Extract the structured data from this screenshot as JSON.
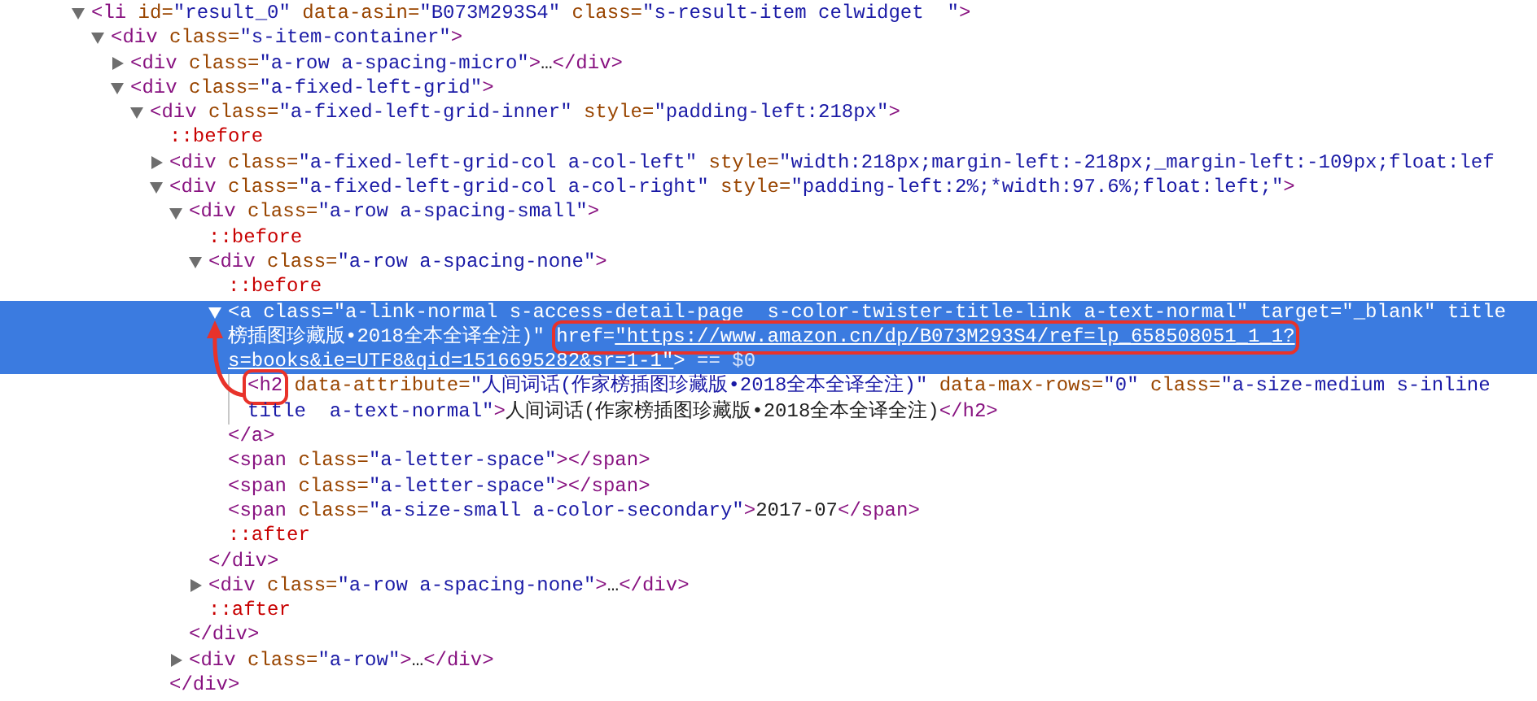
{
  "elements_panel": {
    "nodes": [
      {
        "selected": false,
        "expanded": true,
        "open": [
          {
            "kind": "tag",
            "text": "<li"
          },
          {
            "kind": "attr",
            "text": " id="
          },
          {
            "kind": "value",
            "text": "\"result_0\""
          },
          {
            "kind": "attr",
            "text": " data-asin="
          },
          {
            "kind": "value",
            "text": "\"B073M293S4\""
          },
          {
            "kind": "attr",
            "text": " class="
          },
          {
            "kind": "value",
            "text": "\"s-result-item celwidget  \""
          },
          {
            "kind": "tag",
            "text": ">"
          }
        ],
        "children": [
          {
            "selected": false,
            "expanded": true,
            "open": [
              {
                "kind": "tag",
                "text": "<div"
              },
              {
                "kind": "attr",
                "text": " class="
              },
              {
                "kind": "value",
                "text": "\"s-item-container\""
              },
              {
                "kind": "tag",
                "text": ">"
              }
            ],
            "children": [
              {
                "selected": false,
                "expanded": false,
                "open": [
                  {
                    "kind": "tag",
                    "text": "<div"
                  },
                  {
                    "kind": "attr",
                    "text": " class="
                  },
                  {
                    "kind": "value",
                    "text": "\"a-row a-spacing-micro\""
                  },
                  {
                    "kind": "tag",
                    "text": ">"
                  },
                  {
                    "kind": "text",
                    "text": "…"
                  },
                  {
                    "kind": "tag",
                    "text": "</div>"
                  }
                ]
              },
              {
                "selected": false,
                "expanded": true,
                "open": [
                  {
                    "kind": "tag",
                    "text": "<div"
                  },
                  {
                    "kind": "attr",
                    "text": " class="
                  },
                  {
                    "kind": "value",
                    "text": "\"a-fixed-left-grid\""
                  },
                  {
                    "kind": "tag",
                    "text": ">"
                  }
                ],
                "children": [
                  {
                    "selected": false,
                    "expanded": true,
                    "open": [
                      {
                        "kind": "tag",
                        "text": "<div"
                      },
                      {
                        "kind": "attr",
                        "text": " class="
                      },
                      {
                        "kind": "value",
                        "text": "\"a-fixed-left-grid-inner\""
                      },
                      {
                        "kind": "attr",
                        "text": " style="
                      },
                      {
                        "kind": "value",
                        "text": "\"padding-left:218px\""
                      },
                      {
                        "kind": "tag",
                        "text": ">"
                      }
                    ],
                    "children": [
                      {
                        "selected": false,
                        "open": [
                          {
                            "kind": "pseudo",
                            "text": "::before"
                          }
                        ]
                      },
                      {
                        "selected": false,
                        "expanded": false,
                        "open": [
                          {
                            "kind": "tag",
                            "text": "<div"
                          },
                          {
                            "kind": "attr",
                            "text": " class="
                          },
                          {
                            "kind": "value",
                            "text": "\"a-fixed-left-grid-col a-col-left\""
                          },
                          {
                            "kind": "attr",
                            "text": " style="
                          },
                          {
                            "kind": "value",
                            "text": "\"width:218px;margin-left:-218px;_margin-left:-109px;float:lef"
                          }
                        ]
                      },
                      {
                        "selected": false,
                        "expanded": true,
                        "open": [
                          {
                            "kind": "tag",
                            "text": "<div"
                          },
                          {
                            "kind": "attr",
                            "text": " class="
                          },
                          {
                            "kind": "value",
                            "text": "\"a-fixed-left-grid-col a-col-right\""
                          },
                          {
                            "kind": "attr",
                            "text": " style="
                          },
                          {
                            "kind": "value",
                            "text": "\"padding-left:2%;*width:97.6%;float:left;\""
                          },
                          {
                            "kind": "tag",
                            "text": ">"
                          }
                        ],
                        "children": [
                          {
                            "selected": false,
                            "expanded": true,
                            "open": [
                              {
                                "kind": "tag",
                                "text": "<div"
                              },
                              {
                                "kind": "attr",
                                "text": " class="
                              },
                              {
                                "kind": "value",
                                "text": "\"a-row a-spacing-small\""
                              },
                              {
                                "kind": "tag",
                                "text": ">"
                              }
                            ],
                            "children": [
                              {
                                "selected": false,
                                "open": [
                                  {
                                    "kind": "pseudo",
                                    "text": "::before"
                                  }
                                ]
                              },
                              {
                                "selected": false,
                                "expanded": true,
                                "open": [
                                  {
                                    "kind": "tag",
                                    "text": "<div"
                                  },
                                  {
                                    "kind": "attr",
                                    "text": " class="
                                  },
                                  {
                                    "kind": "value",
                                    "text": "\"a-row a-spacing-none\""
                                  },
                                  {
                                    "kind": "tag",
                                    "text": ">"
                                  }
                                ],
                                "children": [
                                  {
                                    "selected": false,
                                    "open": [
                                      {
                                        "kind": "pseudo",
                                        "text": "::before"
                                      }
                                    ]
                                  },
                                  {
                                    "selected": true,
                                    "expanded": true,
                                    "open": [
                                      {
                                        "kind": "tag",
                                        "text": "<a"
                                      },
                                      {
                                        "kind": "attr",
                                        "text": " class="
                                      },
                                      {
                                        "kind": "value",
                                        "text": "\"a-link-normal s-access-detail-page  s-color-twister-title-link a-text-normal\""
                                      },
                                      {
                                        "kind": "attr",
                                        "text": " target="
                                      },
                                      {
                                        "kind": "value",
                                        "text": "\"_blank\""
                                      },
                                      {
                                        "kind": "attr",
                                        "text": " title"
                                      },
                                      {
                                        "kind": "break"
                                      },
                                      {
                                        "kind": "value",
                                        "text": "榜插图珍藏版•2018全本全译全注)\" "
                                      },
                                      {
                                        "kind": "attr",
                                        "text": "href=",
                                        "boxed": true
                                      },
                                      {
                                        "kind": "link",
                                        "text": "\"https://www.amazon.cn/dp/B073M293S4/ref=lp_658508051_1_1?",
                                        "boxed": true
                                      },
                                      {
                                        "kind": "break"
                                      },
                                      {
                                        "kind": "link",
                                        "text": "s=books&ie=UTF8&qid=1516695282&sr=1-1\""
                                      },
                                      {
                                        "kind": "tag",
                                        "text": ">"
                                      },
                                      {
                                        "kind": "ref",
                                        "text": " == $0"
                                      }
                                    ],
                                    "children": [
                                      {
                                        "selected": false,
                                        "open": [
                                          {
                                            "kind": "tag",
                                            "text": "<h2",
                                            "boxed": true
                                          },
                                          {
                                            "kind": "attr",
                                            "text": " data-attribute="
                                          },
                                          {
                                            "kind": "value",
                                            "text": "\"人间词话(作家榜插图珍藏版•2018全本全译全注)\""
                                          },
                                          {
                                            "kind": "attr",
                                            "text": " data-max-rows="
                                          },
                                          {
                                            "kind": "value",
                                            "text": "\"0\""
                                          },
                                          {
                                            "kind": "attr",
                                            "text": " class="
                                          },
                                          {
                                            "kind": "value",
                                            "text": "\"a-size-medium s-inline"
                                          },
                                          {
                                            "kind": "break"
                                          },
                                          {
                                            "kind": "value",
                                            "text": "title  a-text-normal\""
                                          },
                                          {
                                            "kind": "tag",
                                            "text": ">"
                                          },
                                          {
                                            "kind": "text",
                                            "text": "人间词话(作家榜插图珍藏版•2018全本全译全注)"
                                          },
                                          {
                                            "kind": "tag",
                                            "text": "</h2>"
                                          }
                                        ]
                                      }
                                    ],
                                    "close": [
                                      {
                                        "kind": "tag",
                                        "text": "</a>"
                                      }
                                    ]
                                  },
                                  {
                                    "selected": false,
                                    "open": [
                                      {
                                        "kind": "tag",
                                        "text": "<span"
                                      },
                                      {
                                        "kind": "attr",
                                        "text": " class="
                                      },
                                      {
                                        "kind": "value",
                                        "text": "\"a-letter-space\""
                                      },
                                      {
                                        "kind": "tag",
                                        "text": "></span>"
                                      }
                                    ]
                                  },
                                  {
                                    "selected": false,
                                    "open": [
                                      {
                                        "kind": "tag",
                                        "text": "<span"
                                      },
                                      {
                                        "kind": "attr",
                                        "text": " class="
                                      },
                                      {
                                        "kind": "value",
                                        "text": "\"a-letter-space\""
                                      },
                                      {
                                        "kind": "tag",
                                        "text": "></span>"
                                      }
                                    ]
                                  },
                                  {
                                    "selected": false,
                                    "open": [
                                      {
                                        "kind": "tag",
                                        "text": "<span"
                                      },
                                      {
                                        "kind": "attr",
                                        "text": " class="
                                      },
                                      {
                                        "kind": "value",
                                        "text": "\"a-size-small a-color-secondary\""
                                      },
                                      {
                                        "kind": "tag",
                                        "text": ">"
                                      },
                                      {
                                        "kind": "text",
                                        "text": "2017-07"
                                      },
                                      {
                                        "kind": "tag",
                                        "text": "</span>"
                                      }
                                    ]
                                  },
                                  {
                                    "selected": false,
                                    "open": [
                                      {
                                        "kind": "pseudo",
                                        "text": "::after"
                                      }
                                    ]
                                  }
                                ],
                                "close": [
                                  {
                                    "kind": "tag",
                                    "text": "</div>"
                                  }
                                ]
                              },
                              {
                                "selected": false,
                                "expanded": false,
                                "open": [
                                  {
                                    "kind": "tag",
                                    "text": "<div"
                                  },
                                  {
                                    "kind": "attr",
                                    "text": " class="
                                  },
                                  {
                                    "kind": "value",
                                    "text": "\"a-row a-spacing-none\""
                                  },
                                  {
                                    "kind": "tag",
                                    "text": ">"
                                  },
                                  {
                                    "kind": "text",
                                    "text": "…"
                                  },
                                  {
                                    "kind": "tag",
                                    "text": "</div>"
                                  }
                                ]
                              },
                              {
                                "selected": false,
                                "open": [
                                  {
                                    "kind": "pseudo",
                                    "text": "::after"
                                  }
                                ]
                              }
                            ],
                            "close": [
                              {
                                "kind": "tag",
                                "text": "</div>"
                              }
                            ]
                          },
                          {
                            "selected": false,
                            "expanded": false,
                            "open": [
                              {
                                "kind": "tag",
                                "text": "<div"
                              },
                              {
                                "kind": "attr",
                                "text": " class="
                              },
                              {
                                "kind": "value",
                                "text": "\"a-row\""
                              },
                              {
                                "kind": "tag",
                                "text": ">"
                              },
                              {
                                "kind": "text",
                                "text": "…"
                              },
                              {
                                "kind": "tag",
                                "text": "</div>"
                              }
                            ]
                          }
                        ],
                        "close": [
                          {
                            "kind": "tag",
                            "text": "</div>"
                          }
                        ]
                      }
                    ]
                  }
                ]
              }
            ]
          }
        ]
      }
    ]
  }
}
